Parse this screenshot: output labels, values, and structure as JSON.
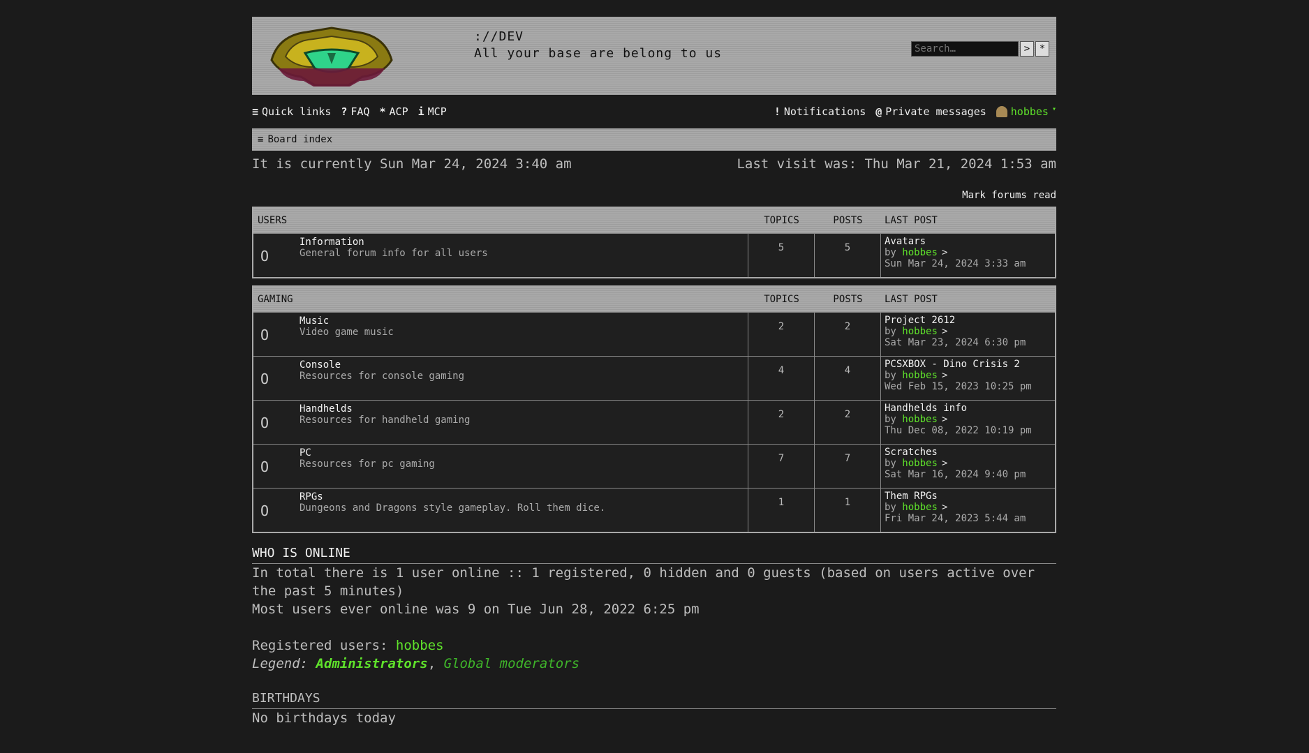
{
  "header": {
    "site_title": "://DEV",
    "site_desc": "All your base are belong to us",
    "search_placeholder": "Search…",
    "search_button": ">",
    "advanced_button": "*"
  },
  "nav": {
    "quick_links": "Quick links",
    "faq": "FAQ",
    "acp": "ACP",
    "mcp": "MCP",
    "notifications": "Notifications",
    "private_messages": "Private messages",
    "username": "hobbes"
  },
  "breadcrumb": "Board index",
  "current_time": "It is currently Sun Mar 24, 2024 3:40 am",
  "last_visit": "Last visit was: Thu Mar 21, 2024 1:53 am",
  "mark_read": "Mark forums read",
  "categories": [
    {
      "name": "USERS",
      "col_topics": "TOPICS",
      "col_posts": "POSTS",
      "col_last": "LAST POST",
      "forums": [
        {
          "title": "Information",
          "desc": "General forum info for all users",
          "topics": "5",
          "posts": "5",
          "last_title": "Avatars",
          "by": "by",
          "last_user": "hobbes",
          "last_date": "Sun Mar 24, 2024 3:33 am"
        }
      ]
    },
    {
      "name": "GAMING",
      "col_topics": "TOPICS",
      "col_posts": "POSTS",
      "col_last": "LAST POST",
      "forums": [
        {
          "title": "Music",
          "desc": "Video game music",
          "topics": "2",
          "posts": "2",
          "last_title": "Project 2612",
          "by": "by",
          "last_user": "hobbes",
          "last_date": "Sat Mar 23, 2024 6:30 pm"
        },
        {
          "title": "Console",
          "desc": "Resources for console gaming",
          "topics": "4",
          "posts": "4",
          "last_title": "PCSXBOX - Dino Crisis 2",
          "by": "by",
          "last_user": "hobbes",
          "last_date": "Wed Feb 15, 2023 10:25 pm"
        },
        {
          "title": "Handhelds",
          "desc": "Resources for handheld gaming",
          "topics": "2",
          "posts": "2",
          "last_title": "Handhelds info",
          "by": "by",
          "last_user": "hobbes",
          "last_date": "Thu Dec 08, 2022 10:19 pm"
        },
        {
          "title": "PC",
          "desc": "Resources for pc gaming",
          "topics": "7",
          "posts": "7",
          "last_title": "Scratches",
          "by": "by",
          "last_user": "hobbes",
          "last_date": "Sat Mar 16, 2024 9:40 pm"
        },
        {
          "title": "RPGs",
          "desc": "Dungeons and Dragons style gameplay. Roll them dice.",
          "topics": "1",
          "posts": "1",
          "last_title": "Them RPGs",
          "by": "by",
          "last_user": "hobbes",
          "last_date": "Fri Mar 24, 2023 5:44 am"
        }
      ]
    }
  ],
  "online": {
    "title": "WHO IS ONLINE",
    "total": "In total there is 1 user online :: 1 registered, 0 hidden and 0 guests (based on users active over the past 5 minutes)",
    "most": "Most users ever online was 9 on Tue Jun 28, 2022 6:25 pm",
    "registered_label": "Registered users:",
    "registered_user": "hobbes",
    "legend_label": "Legend:",
    "legend_admin": "Administrators",
    "legend_sep": ",",
    "legend_gmod": "Global moderators"
  },
  "birthdays": {
    "title": "BIRTHDAYS",
    "text": "No birthdays today"
  },
  "colors": {
    "accent_green": "#5fe22b",
    "bar_gray": "#a9a9a9",
    "background": "#1b1b1b"
  },
  "icons": {
    "logo": "samus-helmet-logo",
    "forum_status": "forum-read-icon",
    "goto_last": "chevron-right-icon"
  }
}
